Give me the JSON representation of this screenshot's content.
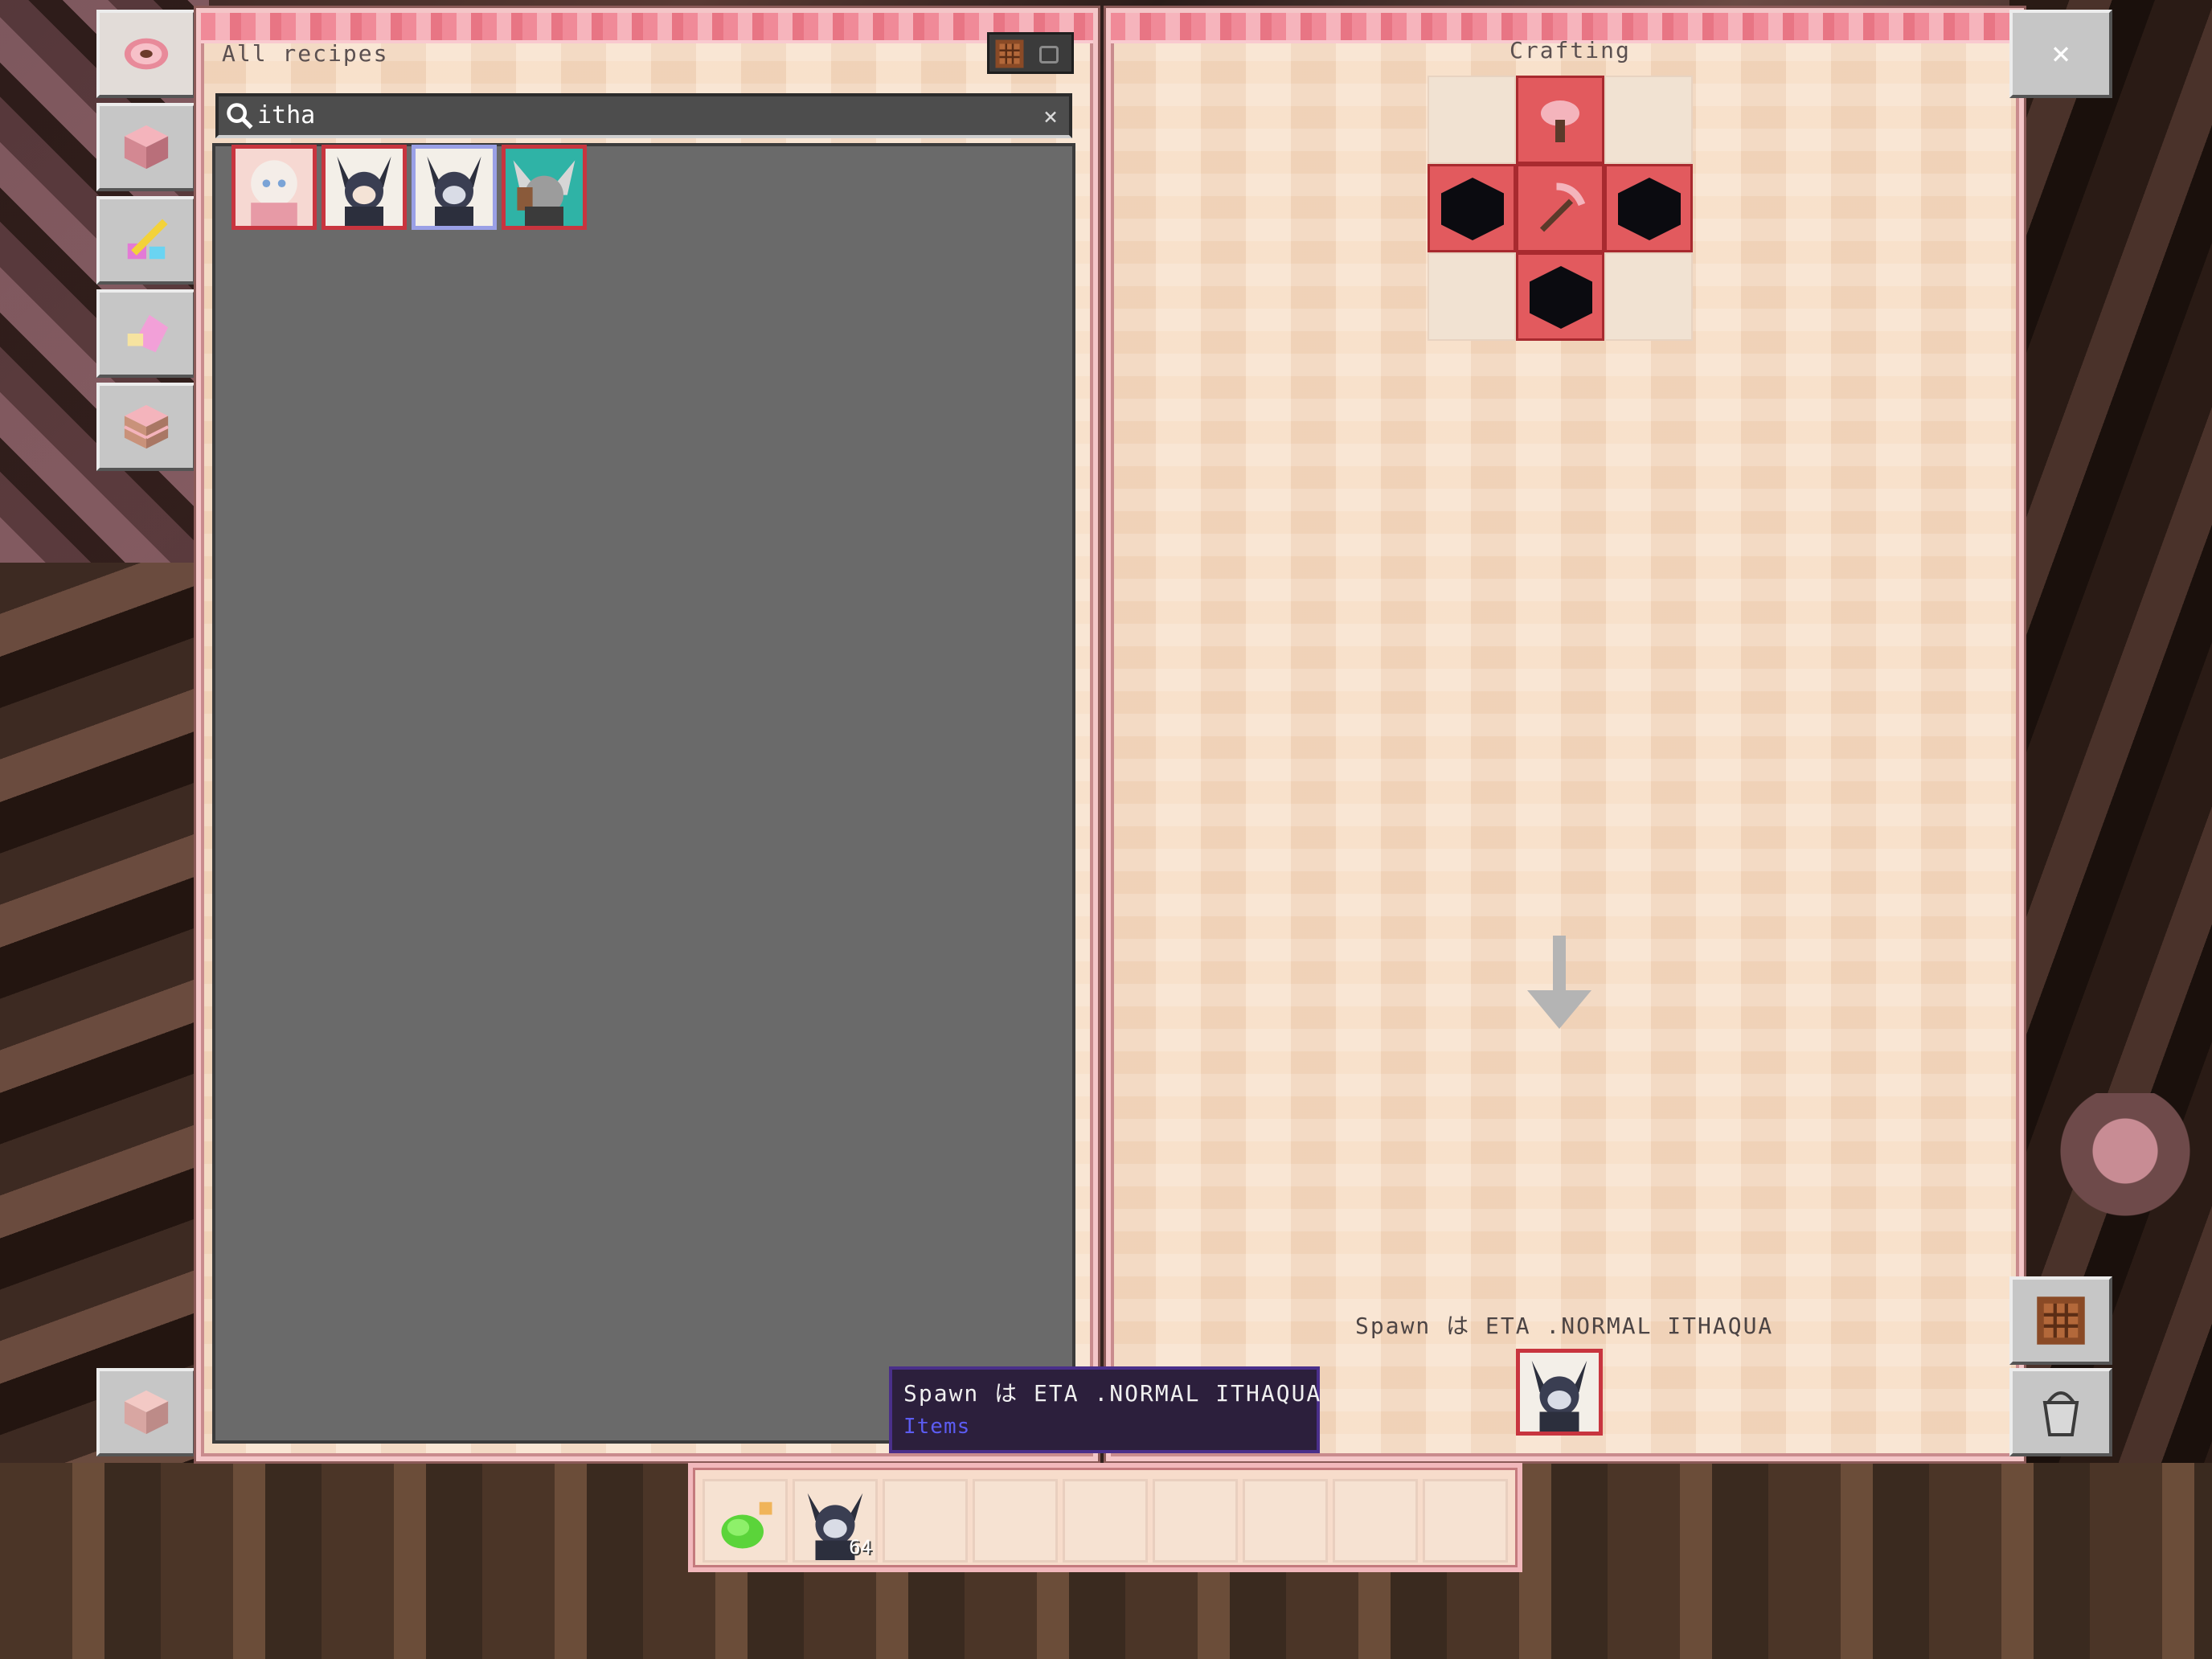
{
  "recipe_book": {
    "title": "All recipes",
    "search": {
      "value": "itha",
      "clear_icon": "×"
    },
    "results": [
      {
        "name": "chibi-girl-white",
        "selected": false
      },
      {
        "name": "ithaqua-dark",
        "selected": false
      },
      {
        "name": "ithaqua-normal",
        "selected": true
      },
      {
        "name": "ithaqua-grey-teal",
        "selected": false
      }
    ],
    "tabs": [
      {
        "name": "tab-search",
        "icon": "donut-icon",
        "active": true
      },
      {
        "name": "tab-building",
        "icon": "pink-block-icon",
        "active": false
      },
      {
        "name": "tab-equipment",
        "icon": "tools-icon",
        "active": false
      },
      {
        "name": "tab-misc",
        "icon": "pink-item-icon",
        "active": false
      },
      {
        "name": "tab-redstone",
        "icon": "cake-block-icon",
        "active": false
      },
      {
        "name": "tab-bottom",
        "icon": "pink-cube-icon",
        "active": false
      }
    ]
  },
  "crafting": {
    "title": "Crafting",
    "grid": [
      [
        "empty",
        "mushroom",
        "empty"
      ],
      [
        "black-block",
        "pickaxe",
        "black-block"
      ],
      [
        "empty",
        "black-block",
        "empty"
      ]
    ],
    "result_label": "Spawn は ETA .NORMAL ITHAQUA",
    "close_icon": "×"
  },
  "tooltip": {
    "line1": "Spawn は ETA .NORMAL ITHAQUA",
    "line2": "Items"
  },
  "hotbar": {
    "slots": [
      {
        "item": "green-potion",
        "count": ""
      },
      {
        "item": "ithaqua-spawn",
        "count": "64"
      },
      {
        "item": "",
        "count": ""
      },
      {
        "item": "",
        "count": ""
      },
      {
        "item": "",
        "count": ""
      },
      {
        "item": "",
        "count": ""
      },
      {
        "item": "",
        "count": ""
      },
      {
        "item": "",
        "count": ""
      },
      {
        "item": "",
        "count": ""
      }
    ]
  },
  "colors": {
    "panel_bg": "#f6dcc4",
    "accent_red": "#e25a5e",
    "trim_pink": "#f08a98",
    "tooltip_bg": "#2c1f3c",
    "tooltip_secondary": "#5c5cf2"
  }
}
